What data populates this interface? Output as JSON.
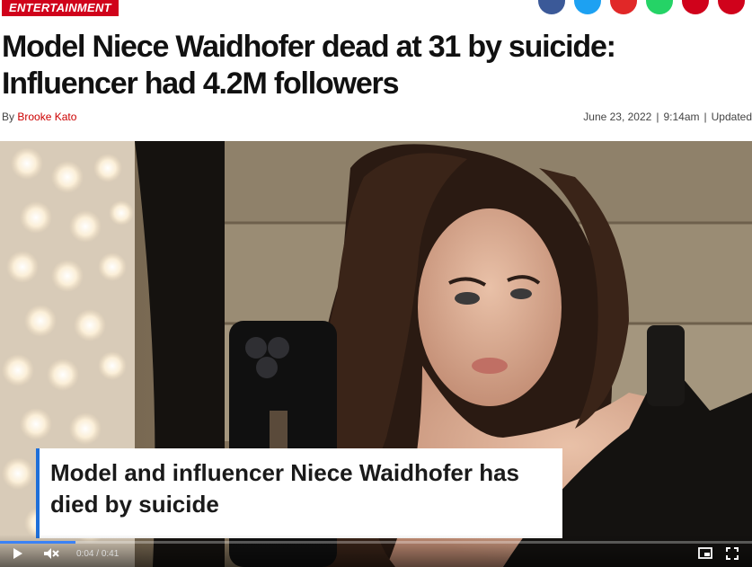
{
  "article": {
    "category": "ENTERTAINMENT",
    "headline": "Model Niece Waidhofer dead at 31 by suicide: Influencer had 4.2M followers",
    "byline_prefix": "By",
    "author": "Brooke Kato",
    "date": "June 23, 2022",
    "time": "9:14am",
    "updated": "Updated",
    "separator": "|"
  },
  "share_icons": [
    {
      "name": "facebook-icon",
      "color": "#3b5998"
    },
    {
      "name": "twitter-icon",
      "color": "#1da1f2"
    },
    {
      "name": "flipboard-icon",
      "color": "#e12828"
    },
    {
      "name": "whatsapp-icon",
      "color": "#25d366"
    },
    {
      "name": "email-icon",
      "color": "#d0021b"
    },
    {
      "name": "link-icon",
      "color": "#d0021b"
    }
  ],
  "video": {
    "caption": "Model and influencer Niece Waidhofer has died by suicide",
    "current_time": "0:04",
    "duration": "0:41",
    "time_separator": "/",
    "progress": 0.1,
    "play_icon": "play-icon",
    "mute_icon": "muted-volume-icon",
    "pip_icon": "picture-in-picture-icon",
    "fullscreen_icon": "fullscreen-icon"
  }
}
